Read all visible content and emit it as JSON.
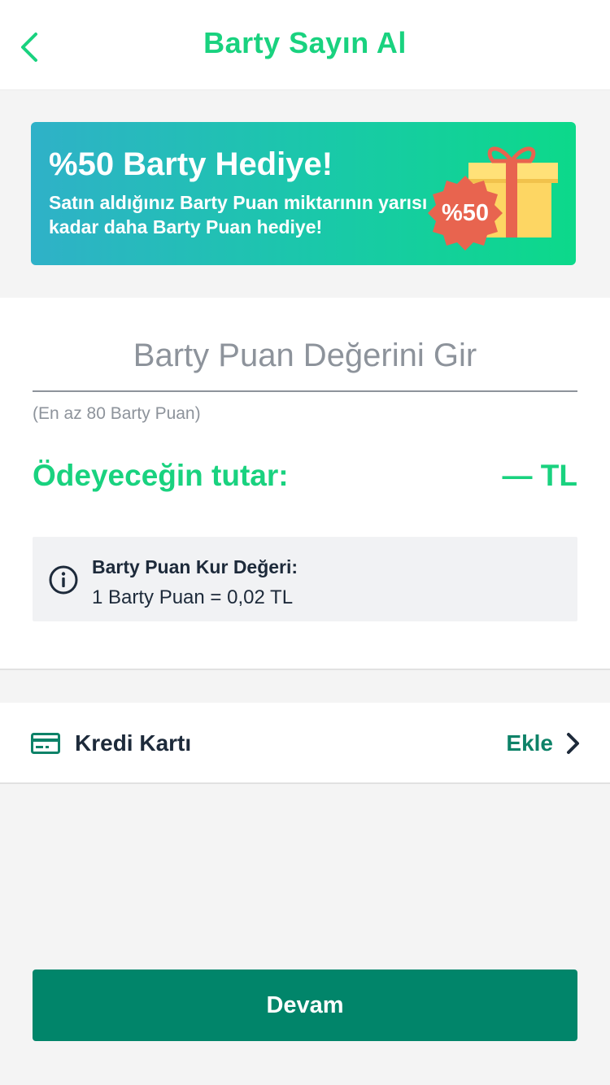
{
  "header": {
    "title": "Barty Sayın Al",
    "back_icon": "chevron-left-icon"
  },
  "banner": {
    "title": "%50 Barty Hediye!",
    "subtitle": "Satın aldığınız Barty Puan miktarının yarısı kadar daha Barty Puan hediye!",
    "badge": "%50",
    "illustration": "gift-box-icon",
    "colors": {
      "gradient_start": "#2fb1c8",
      "gradient_end": "#0cd98a",
      "badge": "#e8644f",
      "gift": "#fdd663",
      "ribbon": "#e8644f"
    }
  },
  "purchase": {
    "input_placeholder": "Barty Puan Değerini Gir",
    "input_value": "",
    "min_hint": "(En az 80 Barty Puan)",
    "pay_label": "Ödeyeceğin tutar:",
    "pay_value": "— TL"
  },
  "rate": {
    "icon": "info-icon",
    "title": "Barty Puan Kur Değeri:",
    "value": "1 Barty Puan = 0,02 TL"
  },
  "payment": {
    "icon": "credit-card-icon",
    "label": "Kredi Kartı",
    "action": "Ekle",
    "action_icon": "chevron-right-icon"
  },
  "footer": {
    "continue_label": "Devam"
  },
  "colors": {
    "accent": "#19d27f",
    "primary_button": "#01856a",
    "text_dark": "#1d2a3a",
    "muted": "#8d939b"
  }
}
